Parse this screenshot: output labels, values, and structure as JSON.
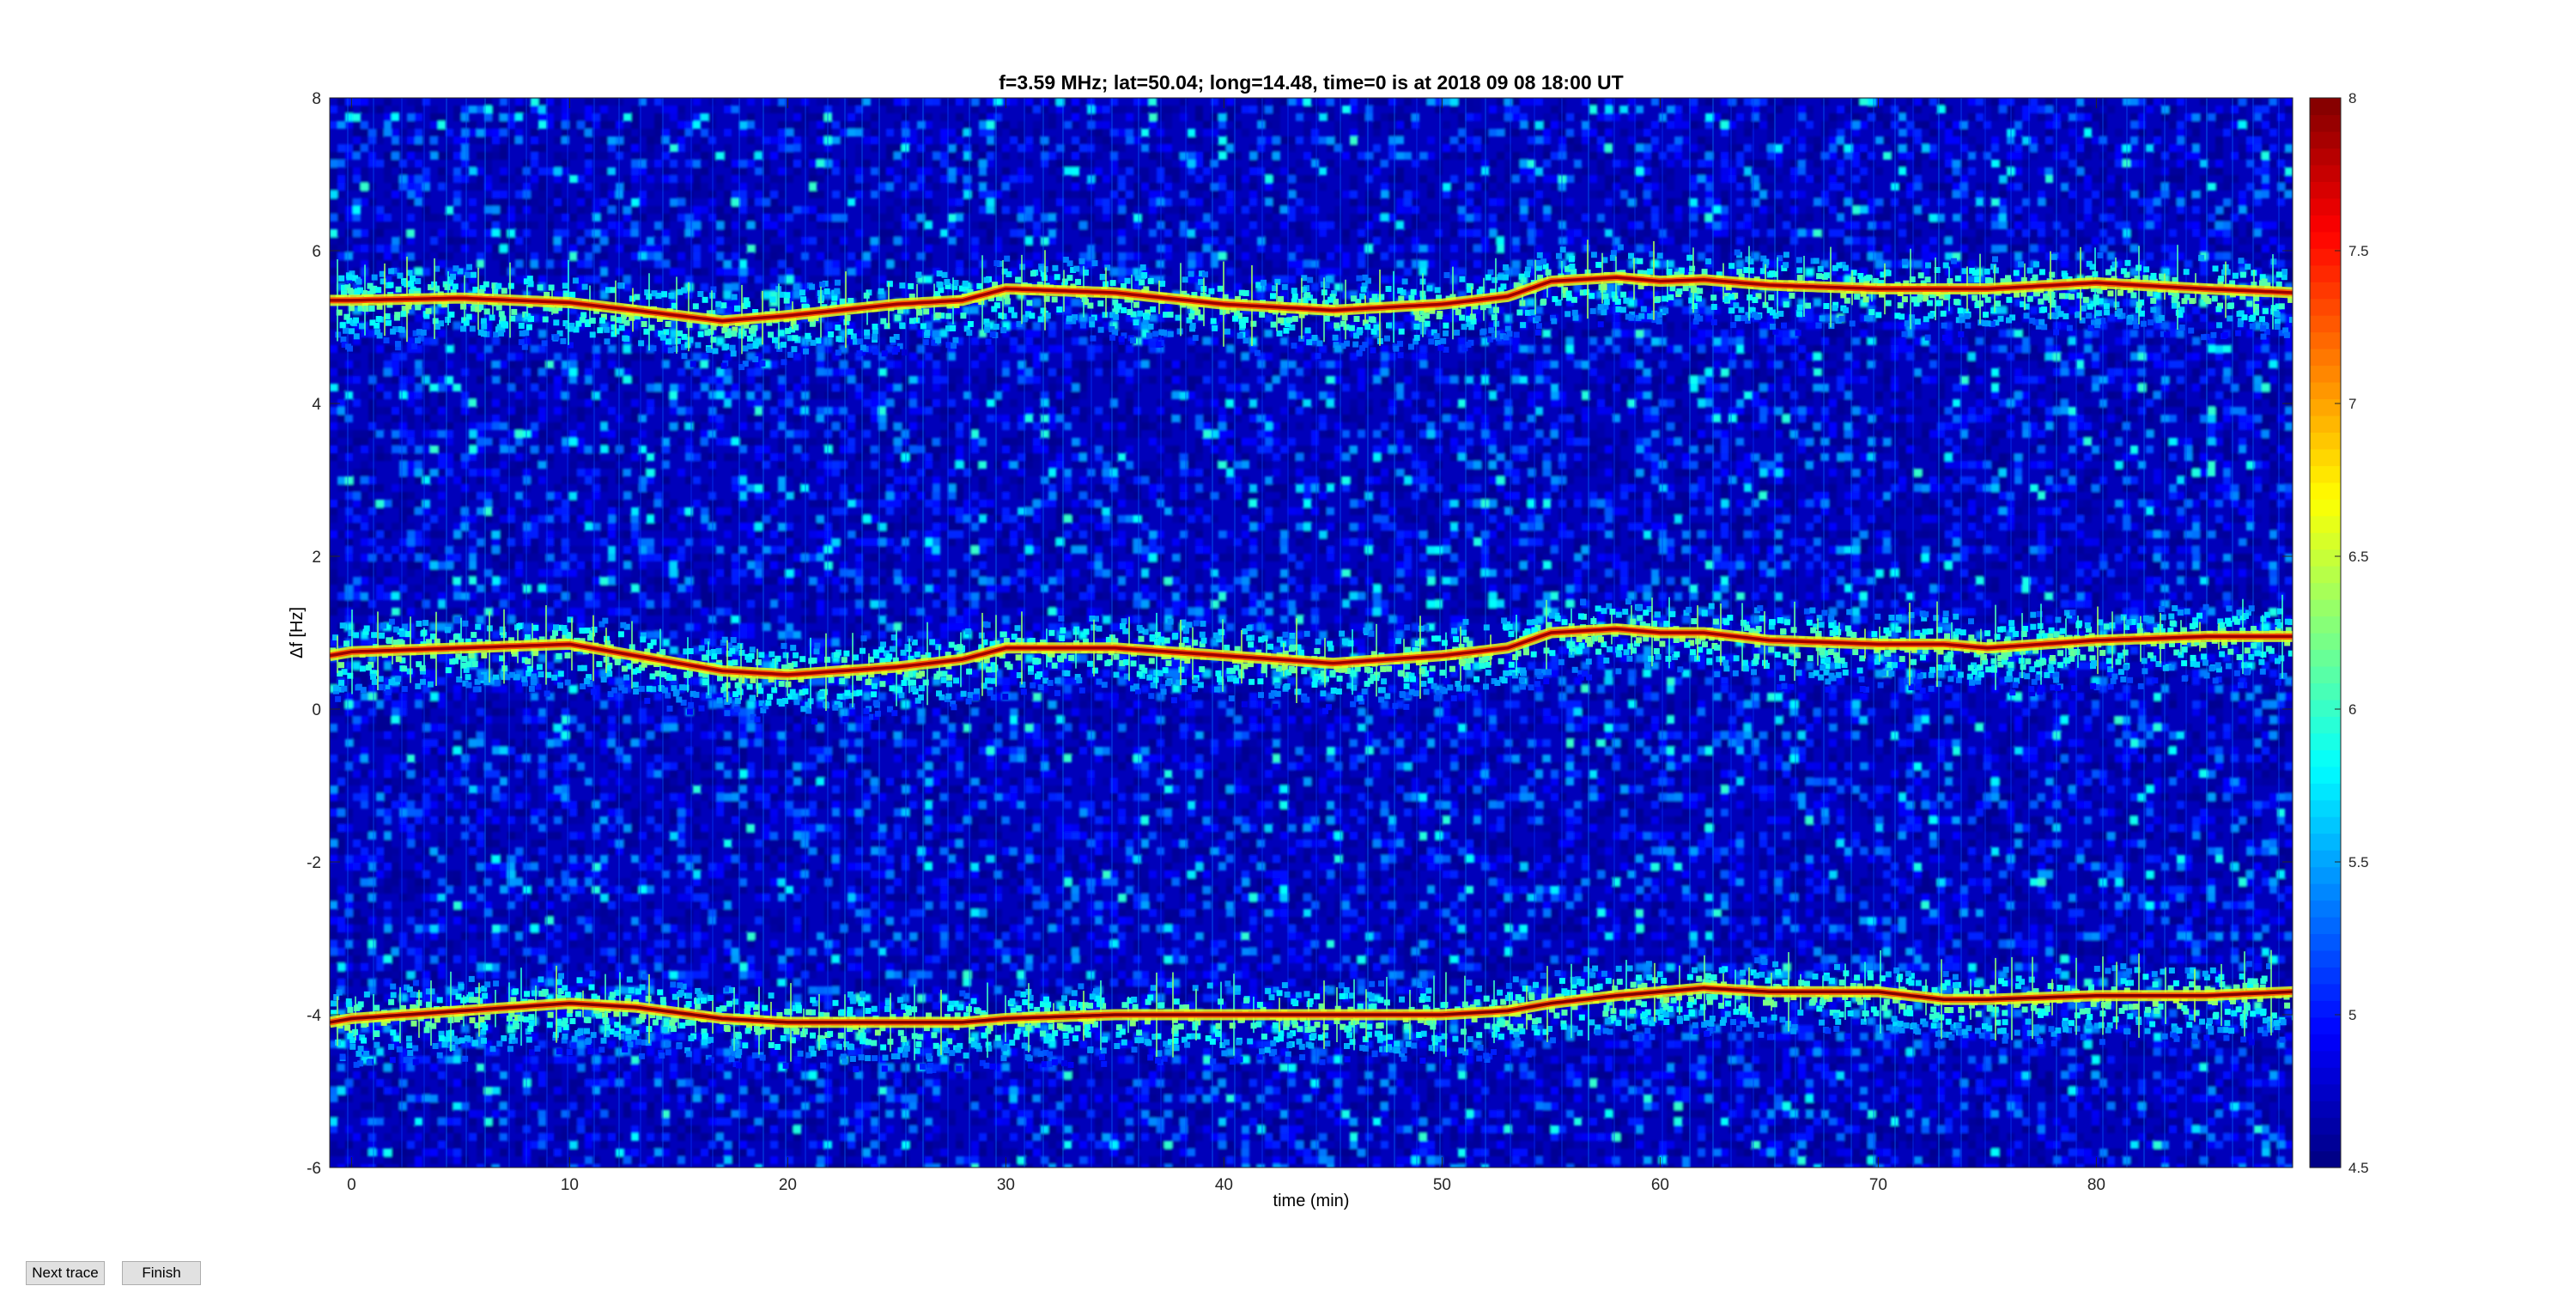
{
  "figure": {
    "buttons": {
      "next_trace": "Next trace",
      "finish": "Finish"
    }
  },
  "chart_data": {
    "type": "heatmap",
    "title": "f=3.59 MHz;  lat=50.04; long=14.48, time=0 is at 2018 09 08 18:00 UT",
    "xlabel": "time (min)",
    "ylabel": "Δf [Hz]",
    "xlim": [
      -1,
      89
    ],
    "ylim": [
      -6,
      8
    ],
    "x_ticks": [
      "0",
      "10",
      "20",
      "30",
      "40",
      "50",
      "60",
      "70",
      "80"
    ],
    "y_ticks": [
      "-6",
      "-4",
      "-2",
      "0",
      "2",
      "4",
      "6",
      "8"
    ],
    "colorbar": {
      "colormap": "jet",
      "clim": [
        4.5,
        8
      ],
      "ticks": [
        "4.5",
        "5",
        "5.5",
        "6",
        "6.5",
        "7",
        "7.5",
        "8"
      ]
    },
    "background_level": 4.7,
    "traces": [
      {
        "x": [
          -1,
          0,
          5,
          10,
          13,
          17,
          20,
          25,
          28,
          30,
          35,
          40,
          45,
          50,
          53,
          55,
          58,
          60,
          62,
          65,
          70,
          73,
          75,
          80,
          85,
          89
        ],
        "y": [
          5.35,
          5.35,
          5.38,
          5.32,
          5.22,
          5.08,
          5.15,
          5.3,
          5.35,
          5.5,
          5.45,
          5.3,
          5.22,
          5.3,
          5.4,
          5.6,
          5.65,
          5.6,
          5.62,
          5.55,
          5.5,
          5.5,
          5.5,
          5.58,
          5.5,
          5.45
        ],
        "peak": 7.9
      },
      {
        "x": [
          -1,
          0,
          5,
          10,
          13,
          17,
          20,
          25,
          28,
          30,
          35,
          40,
          45,
          50,
          53,
          55,
          58,
          60,
          62,
          65,
          70,
          73,
          75,
          80,
          85,
          89
        ],
        "y": [
          0.7,
          0.75,
          0.8,
          0.85,
          0.7,
          0.5,
          0.45,
          0.55,
          0.65,
          0.8,
          0.8,
          0.7,
          0.6,
          0.7,
          0.8,
          1.0,
          1.05,
          1.0,
          1.0,
          0.9,
          0.85,
          0.85,
          0.8,
          0.9,
          0.95,
          0.95
        ],
        "peak": 7.9
      },
      {
        "x": [
          -1,
          0,
          5,
          10,
          13,
          17,
          20,
          25,
          28,
          30,
          35,
          40,
          45,
          50,
          53,
          55,
          58,
          60,
          62,
          65,
          70,
          73,
          75,
          80,
          85,
          89
        ],
        "y": [
          -4.1,
          -4.05,
          -3.95,
          -3.85,
          -3.9,
          -4.05,
          -4.1,
          -4.1,
          -4.1,
          -4.05,
          -4.0,
          -4.0,
          -4.0,
          -4.0,
          -3.95,
          -3.85,
          -3.75,
          -3.7,
          -3.65,
          -3.7,
          -3.7,
          -3.8,
          -3.8,
          -3.75,
          -3.75,
          -3.7
        ],
        "peak": 8.0
      }
    ]
  }
}
